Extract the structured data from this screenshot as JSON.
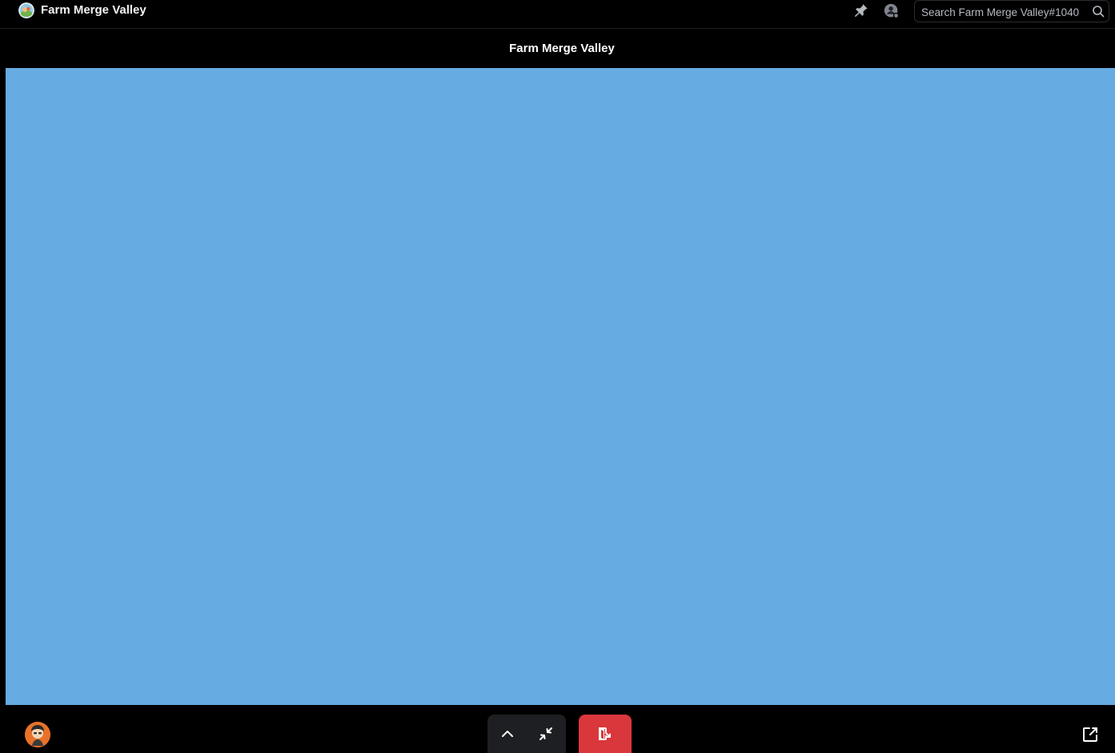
{
  "window": {
    "title": "Farm Merge Valley",
    "app_icon": "farm-merge-valley-logo"
  },
  "toolbar": {
    "pin_icon": "pin-icon",
    "members_icon": "members-icon",
    "search_placeholder": "Search Farm Merge Valley#1040",
    "search_icon": "search-icon"
  },
  "activity": {
    "title": "Farm Merge Valley",
    "background_color": "#66abe1"
  },
  "controls": {
    "avatar_icon": "user-avatar",
    "expand_icon": "chevron-up-icon",
    "minimize_icon": "shrink-arrows-icon",
    "leave_icon": "leave-activity-icon",
    "leave_color": "#da373c",
    "popout_icon": "popout-window-icon"
  }
}
